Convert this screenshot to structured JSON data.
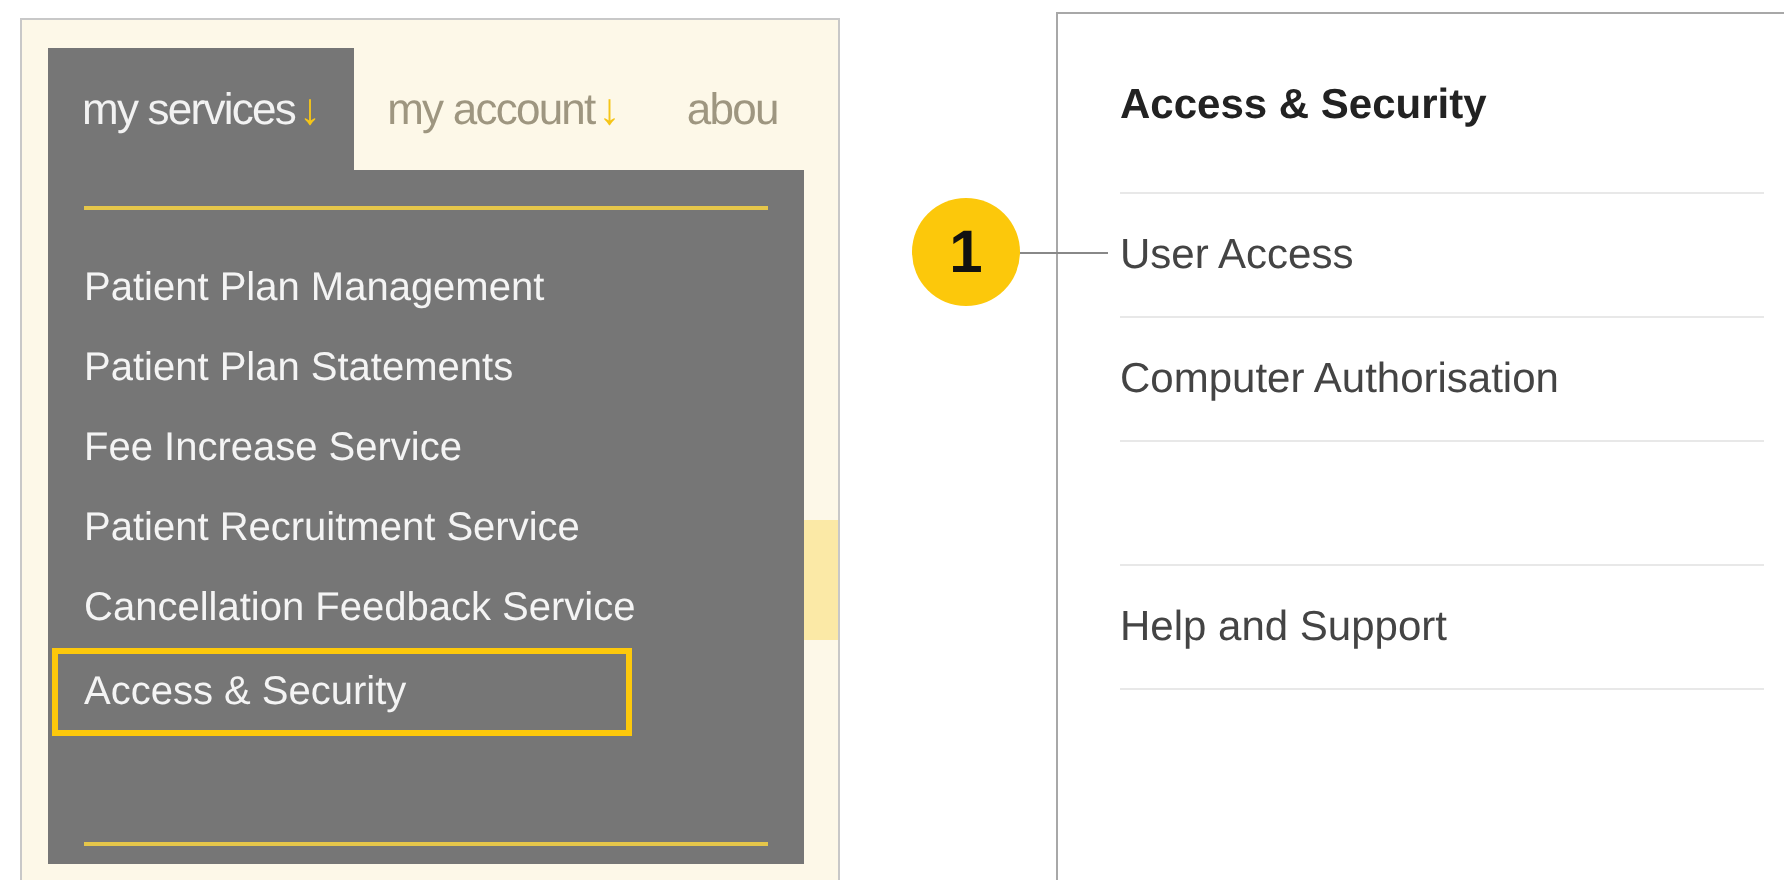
{
  "nav_tabs": [
    {
      "label": "my services",
      "arrow": "↓",
      "selected": true
    },
    {
      "label": "my account",
      "arrow": "↓",
      "selected": false
    },
    {
      "label": "abou",
      "selected": false
    }
  ],
  "dropdown": {
    "items": [
      {
        "label": "Patient Plan Management",
        "selected": false
      },
      {
        "label": "Patient Plan Statements",
        "selected": false
      },
      {
        "label": "Fee Increase Service",
        "selected": false
      },
      {
        "label": "Patient Recruitment Service",
        "selected": false
      },
      {
        "label": "Cancellation Feedback Service",
        "selected": false
      },
      {
        "label": "Access & Security",
        "selected": true
      }
    ]
  },
  "callout": {
    "number": "1"
  },
  "side_panel": {
    "title": "Access & Security",
    "items": [
      {
        "kind": "link",
        "label": "User Access"
      },
      {
        "kind": "link",
        "label": "Computer Authorisation"
      },
      {
        "kind": "spacer"
      },
      {
        "kind": "link",
        "label": "Help and Support"
      }
    ]
  }
}
